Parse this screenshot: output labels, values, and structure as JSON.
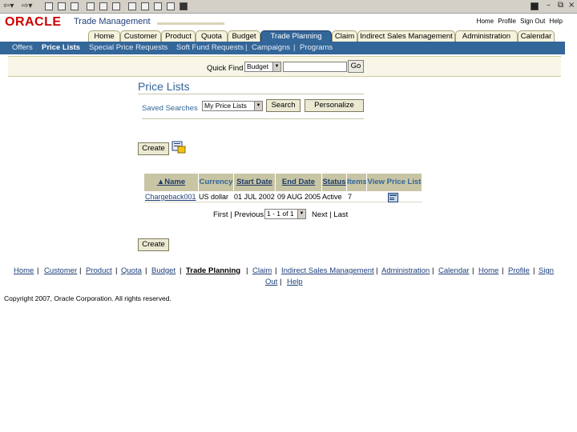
{
  "app": {
    "brand": "ORACLE",
    "product": "Trade Management"
  },
  "global_links": [
    "Home",
    "Profile",
    "Sign Out",
    "Help"
  ],
  "tabs": [
    {
      "label": "Home",
      "active": false
    },
    {
      "label": "Customer",
      "active": false
    },
    {
      "label": "Product",
      "active": false
    },
    {
      "label": "Quota",
      "active": false
    },
    {
      "label": "Budget",
      "active": false
    },
    {
      "label": "Trade Planning",
      "active": true
    },
    {
      "label": "Claim",
      "active": false
    },
    {
      "label": "Indirect Sales Management",
      "active": false
    },
    {
      "label": "Administration",
      "active": false
    },
    {
      "label": "Calendar",
      "active": false
    }
  ],
  "subnav": [
    {
      "label": "Offers",
      "active": false
    },
    {
      "label": "Price Lists",
      "active": true
    },
    {
      "label": "Special Price Requests",
      "active": false
    },
    {
      "label": "Soft Fund Requests",
      "active": false
    },
    {
      "label": "Campaigns",
      "active": false
    },
    {
      "label": "Programs",
      "active": false
    }
  ],
  "quick_find": {
    "label": "Quick Find",
    "selected": "Budget",
    "value": "",
    "go_label": "Go"
  },
  "page": {
    "title": "Price Lists",
    "saved_searches_label": "Saved Searches",
    "saved_search_selected": "My Price Lists",
    "search_label": "Search",
    "personalize_label": "Personalize",
    "create_label": "Create"
  },
  "table": {
    "columns": [
      "Name",
      "Currency",
      "Start Date",
      "End Date",
      "Status",
      "Items",
      "View Price List"
    ],
    "rows": [
      {
        "name": "Chargeback001",
        "currency": "US dollar",
        "start": "01 JUL 2002",
        "end": "09 AUG 2005",
        "status": "Active",
        "items": "7"
      }
    ]
  },
  "pagination": {
    "first_prev": "First | Previous",
    "range": "1 - 1 of 1",
    "next_last": "Next | Last"
  },
  "footer": {
    "links": [
      "Home",
      "Customer",
      "Product",
      "Quota",
      "Budget",
      "Trade Planning",
      "Claim",
      "Indirect Sales Management",
      "Administration",
      "Calendar",
      "Home",
      "Profile",
      "Sign Out",
      "Help"
    ],
    "copyright": "Copyright 2007, Oracle Corporation. All rights reserved."
  }
}
